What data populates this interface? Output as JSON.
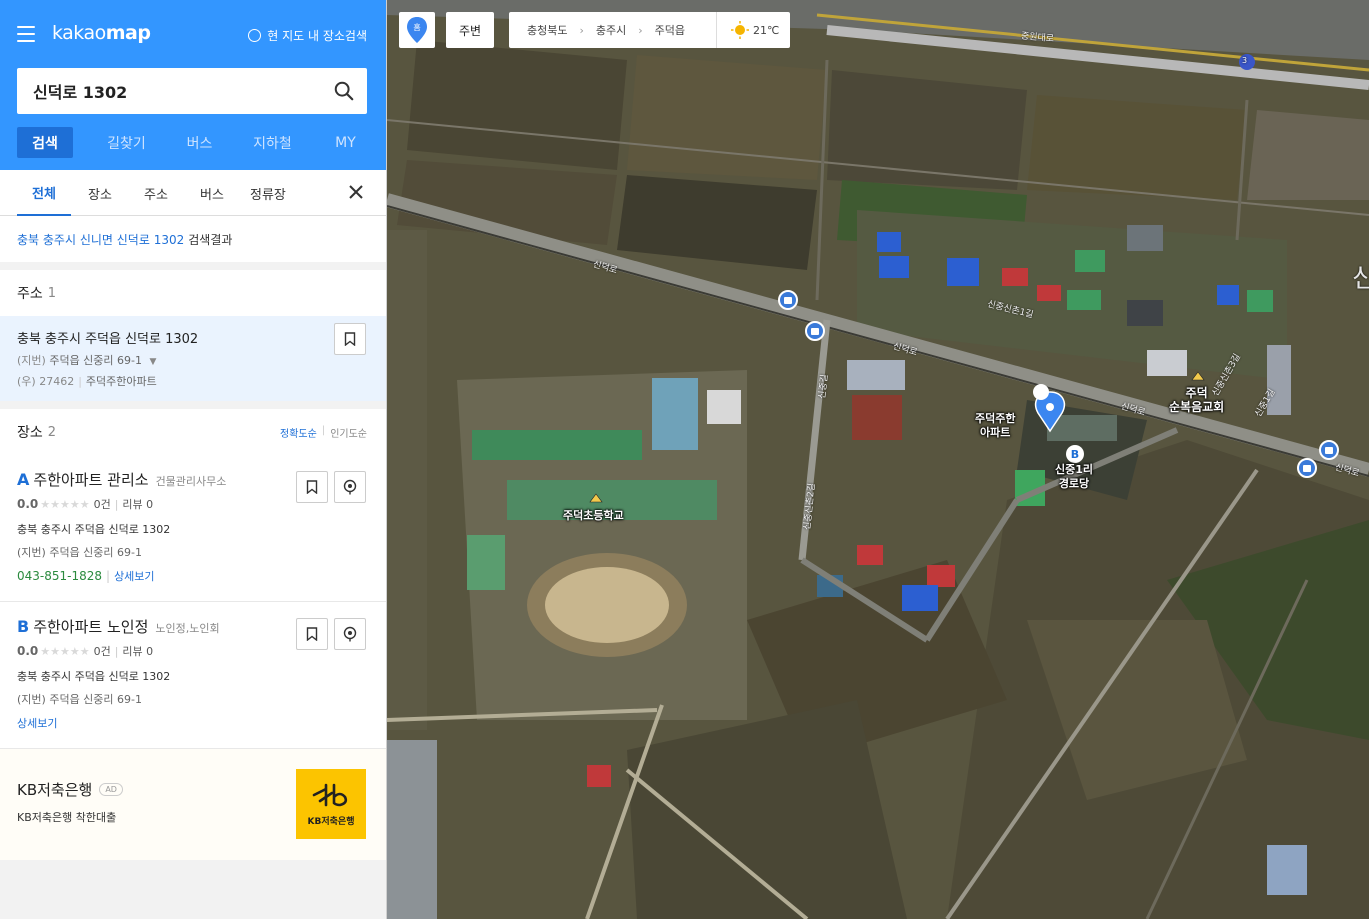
{
  "header": {
    "logo_light": "kakao",
    "logo_bold": "map",
    "map_search_label": "현 지도 내 장소검색",
    "search_value": "신덕로 1302",
    "nav": [
      "검색",
      "길찾기",
      "버스",
      "지하철",
      "MY"
    ]
  },
  "subtabs": [
    "전체",
    "장소",
    "주소",
    "버스",
    "정류장"
  ],
  "result_line": {
    "query": "충북 충주시 신니면 신덕로 1302",
    "suffix": "검색결과"
  },
  "address_section": {
    "title": "주소",
    "count": "1",
    "item": {
      "main": "충북 충주시 주덕읍 신덕로 1302",
      "jibun_label": "(지번)",
      "jibun": "주덕읍 신중리 69-1",
      "zip_label": "(우) 27462",
      "building": "주덕주한아파트"
    }
  },
  "place_section": {
    "title": "장소",
    "count": "2",
    "sort_accuracy": "정확도순",
    "sort_popular": "인기도순",
    "items": [
      {
        "marker": "A",
        "name": "주한아파트 관리소",
        "category": "건물관리사무소",
        "score": "0.0",
        "stars": "★★★★★",
        "count": "0건",
        "review": "리뷰 0",
        "address": "충북 충주시 주덕읍 신덕로 1302",
        "jibun_label": "(지번)",
        "jibun": "주덕읍 신중리 69-1",
        "phone": "043-851-1828",
        "detail": "상세보기"
      },
      {
        "marker": "B",
        "name": "주한아파트 노인정",
        "category": "노인정,노인회",
        "score": "0.0",
        "stars": "★★★★★",
        "count": "0건",
        "review": "리뷰 0",
        "address": "충북 충주시 주덕읍 신덕로 1302",
        "jibun_label": "(지번)",
        "jibun": "주덕읍 신중리 69-1",
        "detail": "상세보기"
      }
    ]
  },
  "ad": {
    "name": "KB저축은행",
    "badge": "AD",
    "desc": "KB저축은행 착한대출",
    "logo_sub": "KB저축은행"
  },
  "map": {
    "pin_label": "홈",
    "nearby": "주변",
    "breadcrumb": [
      "충청북도",
      "충주시",
      "주덕읍"
    ],
    "temperature": "21℃",
    "labels": {
      "school": "주덕초등학교",
      "apartment": "주덕주한\n아파트",
      "senior": "신중1리\n경로당",
      "church": "주덕\n순복음교회"
    },
    "roads": {
      "highway": "중원대로",
      "route_no": "3",
      "sinduk1": "신덕로",
      "sinduk2": "신덕로",
      "sinduk3": "신덕로",
      "sinduk4": "신덕로",
      "side1": "신중신촌1길",
      "side2": "신중길",
      "side3": "신중신촌2길",
      "side4": "신중신촌3길",
      "side5": "신중1길"
    },
    "edge_glyph": "신"
  },
  "colors": {
    "brand_blue": "#3396ff",
    "active_blue": "#1e6fd6",
    "phone_green": "#2b8a3e",
    "kb_yellow": "#fcc400"
  }
}
